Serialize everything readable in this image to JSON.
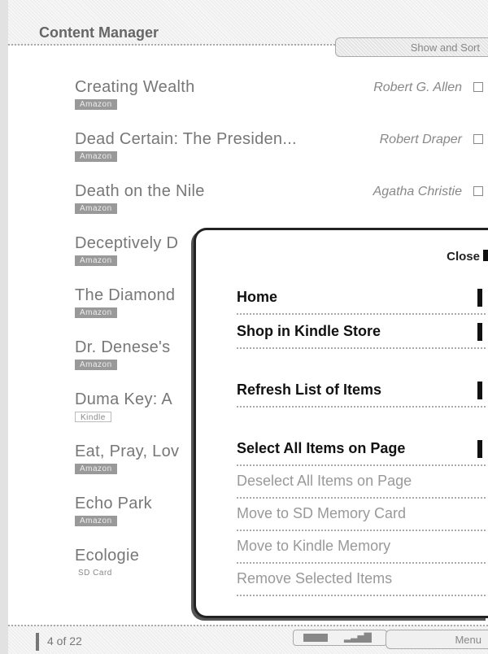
{
  "header": {
    "title": "Content Manager",
    "show_sort_label": "Show and Sort"
  },
  "items": [
    {
      "title": "Creating Wealth",
      "author": "Robert G. Allen",
      "tag": "Amazon"
    },
    {
      "title": "Dead Certain: The Presiden...",
      "author": "Robert Draper",
      "tag": "Amazon"
    },
    {
      "title": "Death on the Nile",
      "author": "Agatha Christie",
      "tag": "Amazon"
    },
    {
      "title": "Deceptively D",
      "author": "",
      "tag": "Amazon"
    },
    {
      "title": "The Diamond",
      "author": "",
      "tag": "Amazon"
    },
    {
      "title": "Dr. Denese's",
      "author": "",
      "tag": "Amazon"
    },
    {
      "title": "Duma Key: A",
      "author": "",
      "tag": "Kindle"
    },
    {
      "title": "Eat, Pray, Lov",
      "author": "",
      "tag": "Amazon"
    },
    {
      "title": "Echo Park",
      "author": "",
      "tag": "Amazon"
    },
    {
      "title": "Ecologie",
      "author": "",
      "tag": "SD Card"
    }
  ],
  "menu": {
    "close_label": "Close",
    "items": [
      {
        "label": "Home",
        "enabled": true
      },
      {
        "label": "Shop in Kindle Store",
        "enabled": true
      },
      {
        "label": "Refresh List of Items",
        "enabled": true
      },
      {
        "label": "Select All Items on Page",
        "enabled": true
      },
      {
        "label": "Deselect All Items on Page",
        "enabled": false
      },
      {
        "label": "Move to SD Memory Card",
        "enabled": false
      },
      {
        "label": "Move to Kindle Memory",
        "enabled": false
      },
      {
        "label": "Remove Selected Items",
        "enabled": false
      }
    ]
  },
  "footer": {
    "page": "4 of 22",
    "menu_label": "Menu"
  },
  "icons": {
    "battery": "battery-icon",
    "signal": "signal-strength-icon",
    "checkbox": "checkbox-icon"
  }
}
